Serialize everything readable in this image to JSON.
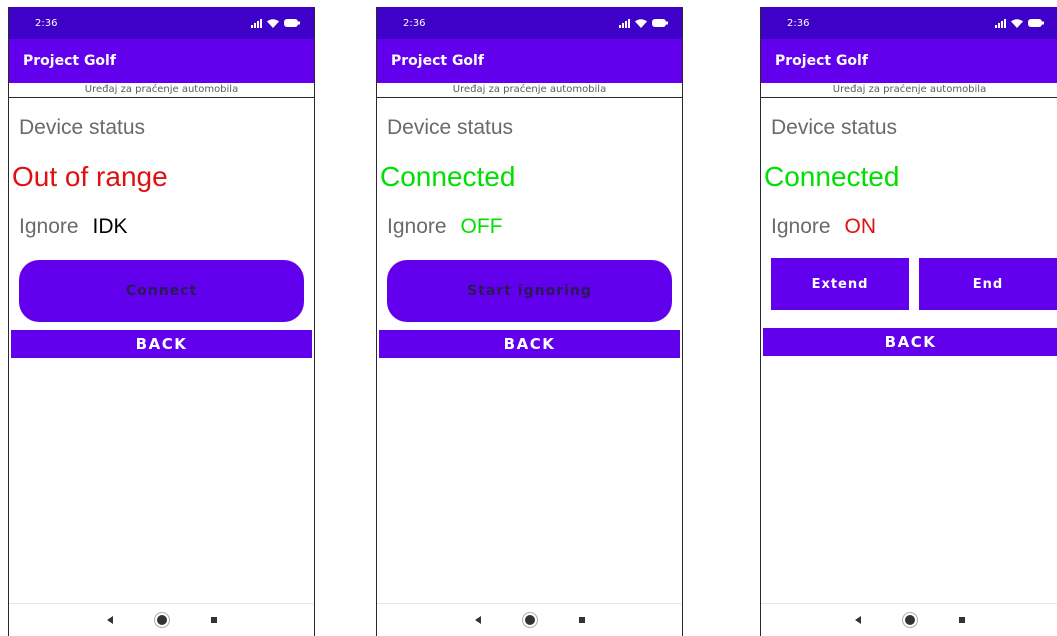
{
  "colors": {
    "statusbar": "#3f00c8",
    "primary": "#6200ee",
    "red": "#e01010",
    "green": "#00e000",
    "black": "#000000"
  },
  "screens": [
    {
      "time": "2:36",
      "app_title": "Project Golf",
      "subtitle": "Uređaj za praćenje automobila",
      "device_status_label": "Device status",
      "connection_status": "Out of range",
      "connection_color": "#e01010",
      "ignore_label": "Ignore",
      "ignore_value": "IDK",
      "ignore_color": "#000000",
      "action_button": "Connect",
      "back_label": "BACK"
    },
    {
      "time": "2:36",
      "app_title": "Project Golf",
      "subtitle": "Uređaj za praćenje automobila",
      "device_status_label": "Device status",
      "connection_status": "Connected",
      "connection_color": "#00e000",
      "ignore_label": "Ignore",
      "ignore_value": "OFF",
      "ignore_color": "#00e000",
      "action_button": "Start ignoring",
      "back_label": "BACK"
    },
    {
      "time": "2:36",
      "app_title": "Project Golf",
      "subtitle": "Uređaj za praćenje automobila",
      "device_status_label": "Device status",
      "connection_status": "Connected",
      "connection_color": "#00e000",
      "ignore_label": "Ignore",
      "ignore_value": "ON",
      "ignore_color": "#e01010",
      "extend_button": "Extend",
      "end_button": "End",
      "back_label": "BACK"
    }
  ],
  "icons": {
    "signal": "signal-icon",
    "wifi": "wifi-icon",
    "battery": "battery-icon",
    "nav_back": "back-triangle-icon",
    "nav_home": "home-circle-icon",
    "nav_recent": "recent-square-icon"
  }
}
